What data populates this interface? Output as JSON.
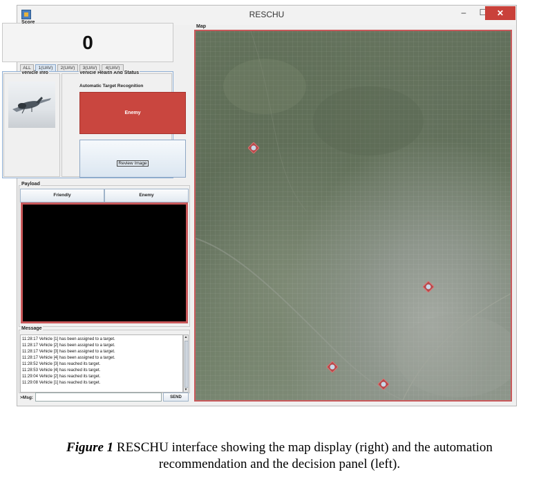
{
  "window": {
    "title": "RESCHU",
    "min_label": "–",
    "max_label": "☐",
    "close_label": "✕"
  },
  "score": {
    "label": "Score",
    "value": "0"
  },
  "tabs": [
    {
      "label": "ALL",
      "selected": false
    },
    {
      "label": "1(UAV)",
      "selected": true
    },
    {
      "label": "2(UAV)",
      "selected": false
    },
    {
      "label": "3(UAV)",
      "selected": false
    },
    {
      "label": "4(UAV)",
      "selected": false
    }
  ],
  "vehicle_info": {
    "label": "Vehicle Info"
  },
  "vehicle_health": {
    "label": "Vehicle Health And Status",
    "atr_label": "Automatic Target Recognition",
    "recommendation": "Enemy",
    "review_button": "Review Image",
    "recommendation_color": "#c9463f"
  },
  "payload": {
    "label": "Payload",
    "friendly_button": "Friendly",
    "enemy_button": "Enemy"
  },
  "message": {
    "label": "Message",
    "lines": [
      "11:28:17  Vehicle [1] has been assigned to a target.",
      "11:28:17  Vehicle [2] has been assigned to a target.",
      "11:28:17  Vehicle [3] has been assigned to a target.",
      "11:28:17  Vehicle [4] has been assigned to a target.",
      "11:28:52  Vehicle [3] has reached its target.",
      "11:28:53  Vehicle [4] has reached its target.",
      "11:29:04  Vehicle [2] has reached its target.",
      "11:29:08  Vehicle [1] has reached its target."
    ],
    "input_label": ">Msg:",
    "input_value": "",
    "send_button": "SEND"
  },
  "map": {
    "label": "Map",
    "uavs": [
      {
        "id": "1"
      },
      {
        "id": "2"
      },
      {
        "id": "3"
      },
      {
        "id": "4"
      }
    ],
    "frame_color": "#c9585a"
  },
  "caption": {
    "figure": "Figure 1",
    "text": " RESCHU interface showing the map display (right) and the automation",
    "text2": "recommendation and the decision panel (left)."
  }
}
